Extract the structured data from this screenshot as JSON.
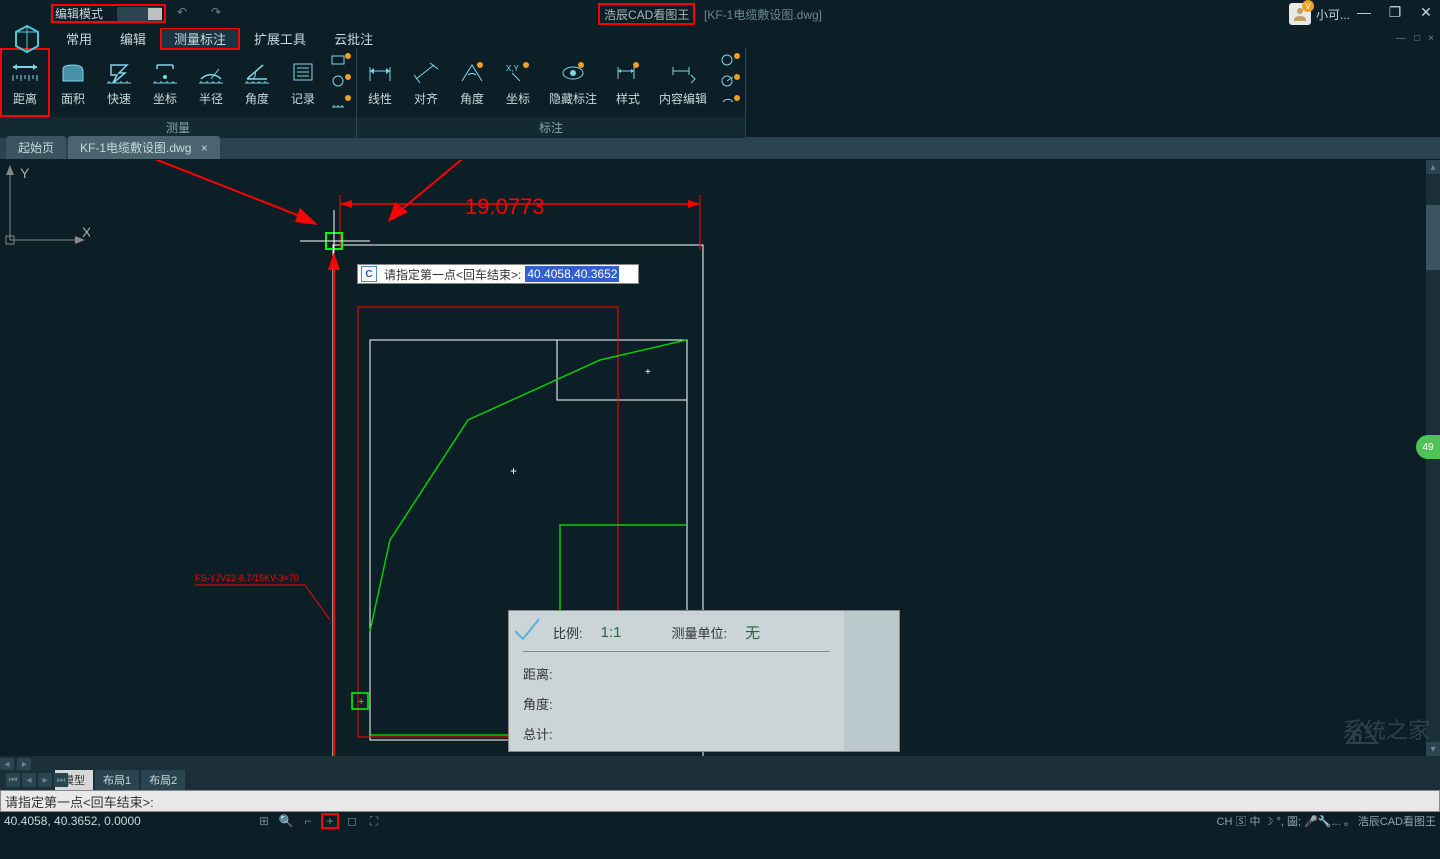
{
  "titlebar": {
    "mode_label": "编辑模式",
    "app_title": "浩辰CAD看图王",
    "doc_title": "[KF-1电缆敷设图.dwg]",
    "user_name": "小可..."
  },
  "menu": {
    "items": [
      "常用",
      "编辑",
      "测量标注",
      "扩展工具",
      "云批注"
    ],
    "active_index": 2
  },
  "ribbon": {
    "group1_label": "测量",
    "group2_label": "标注",
    "measure_buttons": [
      {
        "icon": "distance",
        "label": "距离"
      },
      {
        "icon": "area",
        "label": "面积"
      },
      {
        "icon": "quick",
        "label": "快速"
      },
      {
        "icon": "coord",
        "label": "坐标"
      },
      {
        "icon": "radius",
        "label": "半径"
      },
      {
        "icon": "angle",
        "label": "角度"
      },
      {
        "icon": "record",
        "label": "记录"
      }
    ],
    "annotate_buttons": [
      {
        "icon": "linear",
        "label": "线性"
      },
      {
        "icon": "align",
        "label": "对齐"
      },
      {
        "icon": "angle2",
        "label": "角度"
      },
      {
        "icon": "coord2",
        "label": "坐标"
      },
      {
        "icon": "hide",
        "label": "隐藏标注"
      },
      {
        "icon": "style",
        "label": "样式"
      },
      {
        "icon": "edit",
        "label": "内容编辑"
      }
    ]
  },
  "tabs": {
    "start": "起始页",
    "doc": "KF-1电缆敷设图.dwg"
  },
  "canvas": {
    "dimension_text": "19.0773",
    "wire_label": "FS-YJV22-8.7/15KV-3×70",
    "prompt_label": "请指定第一点<回车结束>:",
    "input_value": "40.4058,40.3652",
    "green_badge": "49"
  },
  "measure_panel": {
    "ratio_label": "比例:",
    "ratio_value": "1:1",
    "unit_label": "测量单位:",
    "unit_value": "无",
    "distance_label": "距离:",
    "angle_label": "角度:",
    "total_label": "总计:"
  },
  "layout_tabs": [
    "模型",
    "布局1",
    "布局2"
  ],
  "cmdbar": {
    "text": "请指定第一点<回车结束>:"
  },
  "statusbar": {
    "coords": "40.4058, 40.3652, 0.0000",
    "right_text": "CH 🅂 中 ☽ °, 圖; 🎤🔧... 。 浩辰CAD看图王"
  },
  "watermark": "系统之家"
}
